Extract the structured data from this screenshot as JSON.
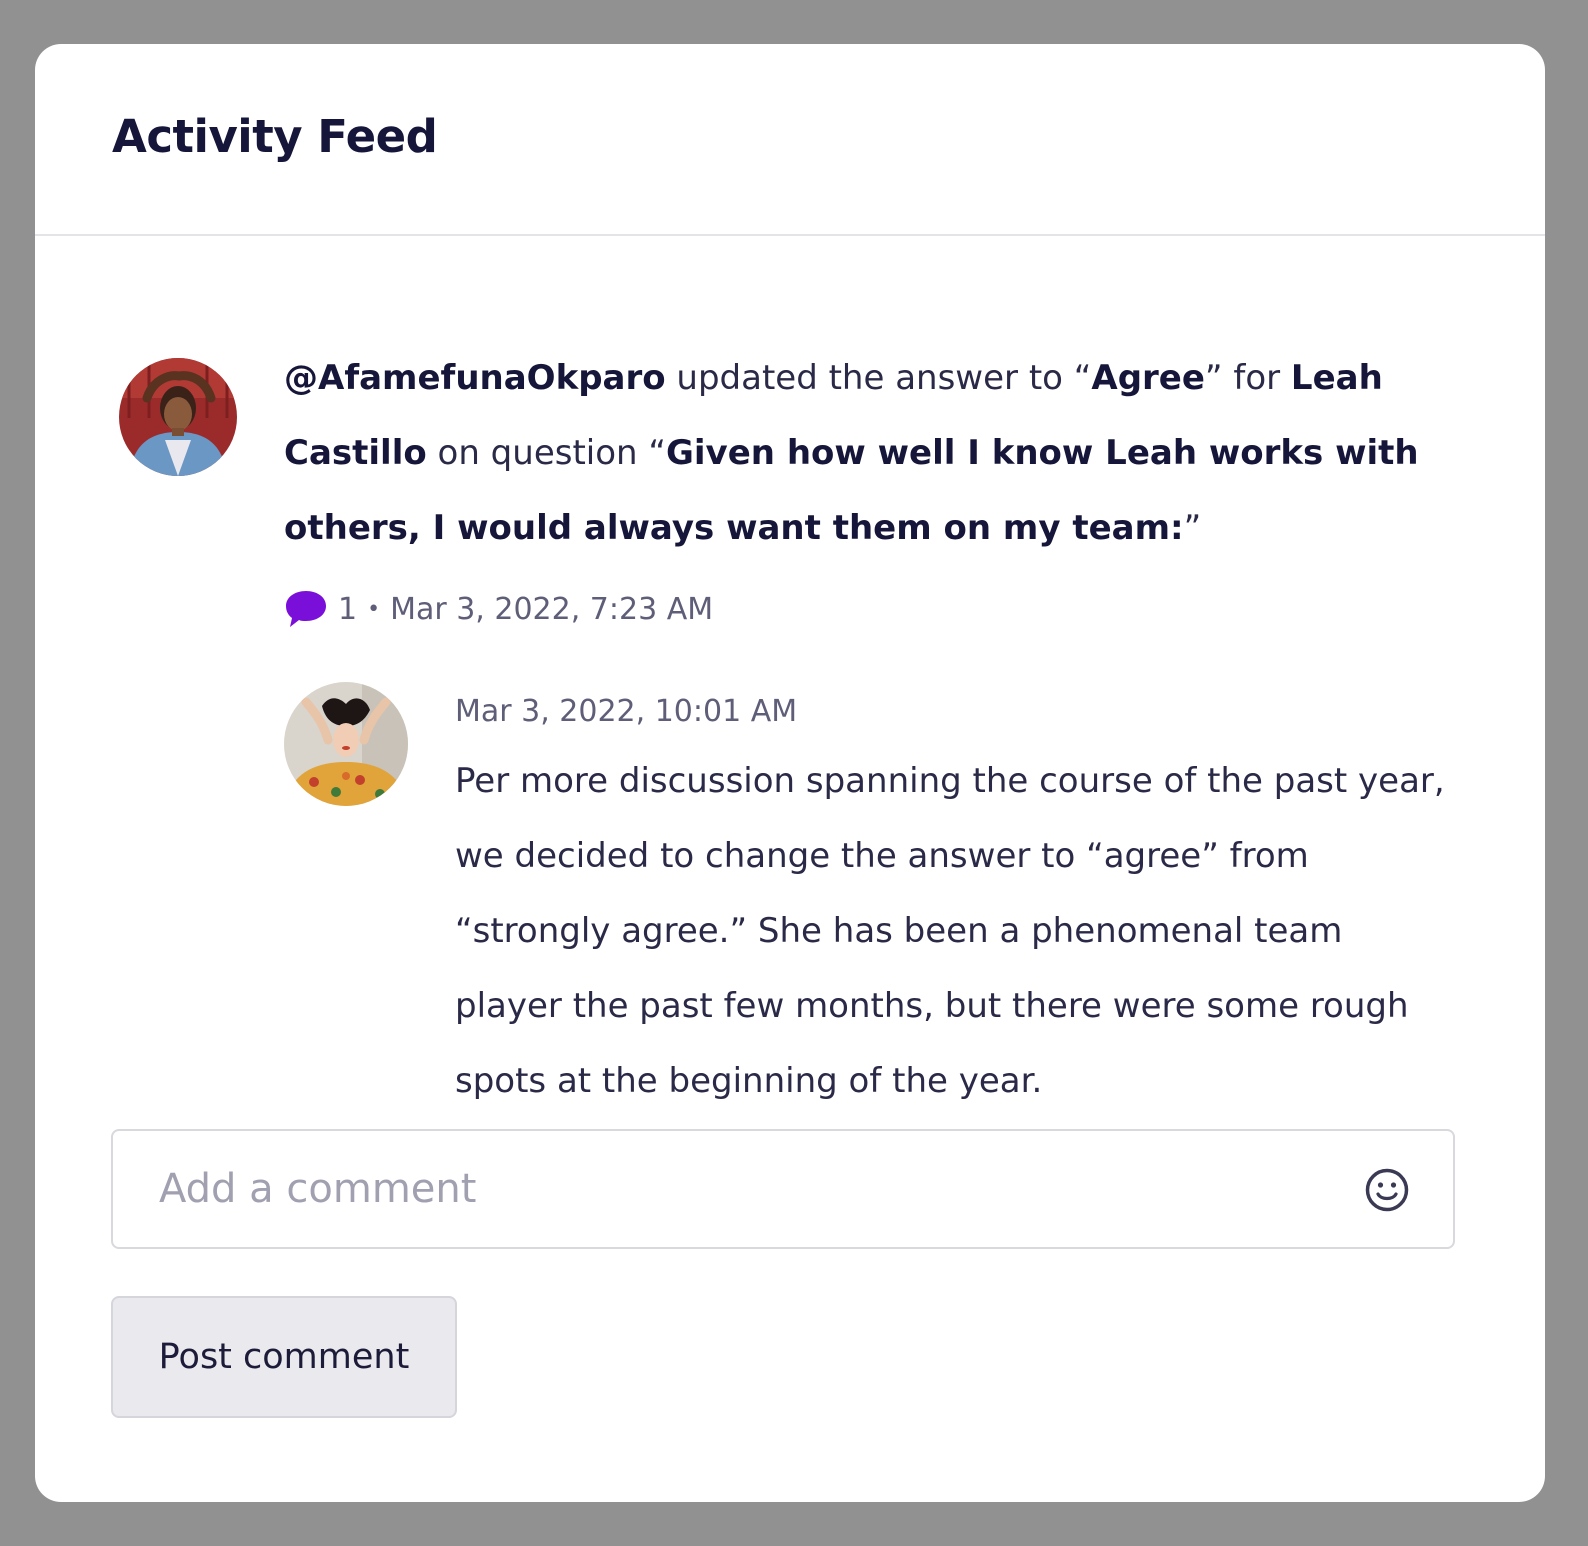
{
  "header": {
    "title": "Activity Feed"
  },
  "activity": {
    "user_handle": "@AfamefunaOkparo",
    "text_updated": " updated the answer to “",
    "answer": "Agree",
    "text_for": "” for ",
    "subject_name": "Leah Castillo",
    "text_on_question": " on question “",
    "question": "Given how well I know Leah works with others, I would always want them on my team:",
    "text_close": "”",
    "comment_count": "1",
    "bullet": "•",
    "timestamp": "Mar 3, 2022, 7:23 AM"
  },
  "reply": {
    "timestamp": "Mar 3, 2022, 10:01 AM",
    "text": "Per more discussion spanning the course of the past year, we decided to change the answer to “agree” from “strongly agree.” She has been a phenomenal team player the past few months, but there were some rough spots at the beginning of the year."
  },
  "comment_form": {
    "placeholder": "Add a comment",
    "value": "",
    "emoji_icon": "smiley-icon",
    "post_label": "Post comment"
  },
  "colors": {
    "page_background": "#919191",
    "card": "#ffffff",
    "accent_purple": "#7a0fd9",
    "text_dark": "#16163a",
    "text_muted": "#5e5e78"
  }
}
